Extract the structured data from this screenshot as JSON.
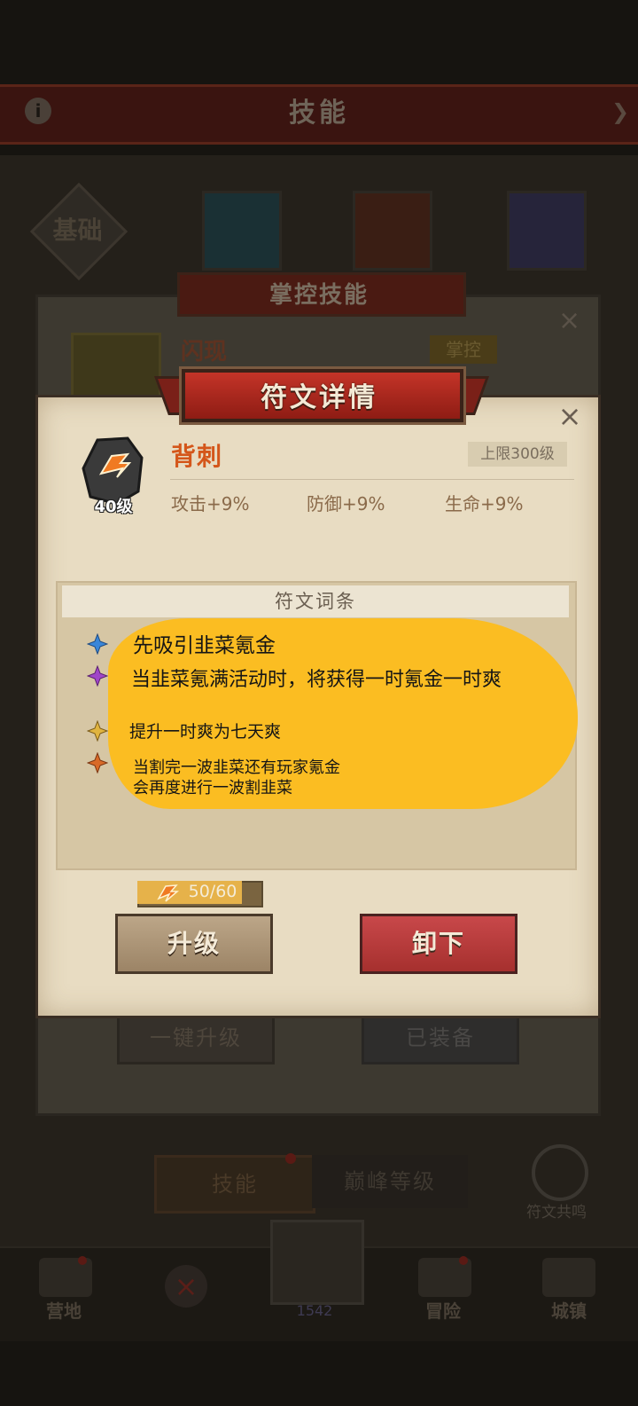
{
  "background": {
    "top_title": "技能",
    "info_icon": "i",
    "tab_basic": "基础",
    "panel_banner": "掌控技能",
    "skill_name": "闪现",
    "skill_tag": "掌控",
    "btn_upgrade_all": "一键升级",
    "btn_equipped": "已装备",
    "seg_skill": "技能",
    "seg_peak": "巅峰等级",
    "resonance_label": "符文共鸣",
    "nav": {
      "camp": "营地",
      "center_count": "1542",
      "adventure": "冒险",
      "town": "城镇"
    }
  },
  "modal": {
    "title": "符文详情",
    "close_icon": "×",
    "rune": {
      "name": "背刺",
      "level": "40级",
      "cap": "上限300级",
      "stats": [
        "攻击+9%",
        "防御+9%",
        "生命+9%"
      ]
    },
    "entries_header": "符文词条",
    "entries": [
      {
        "color": "#3a86d8",
        "text": "先吸引韭菜氪金"
      },
      {
        "color": "#a046c8",
        "text": "当韭菜氪满活动时，将获得一时氪金一时爽"
      },
      {
        "color": "#d8a838",
        "text": "提升一时爽为七天爽"
      },
      {
        "color": "#d86a28",
        "text_line1": "当割完一波韭菜还有玩家氪金",
        "text_line2": "会再度进行一波割韭菜"
      }
    ],
    "progress": {
      "text": "50/60",
      "fraction": 0.8333
    },
    "btn_upgrade": "升级",
    "btn_unequip": "卸下"
  }
}
